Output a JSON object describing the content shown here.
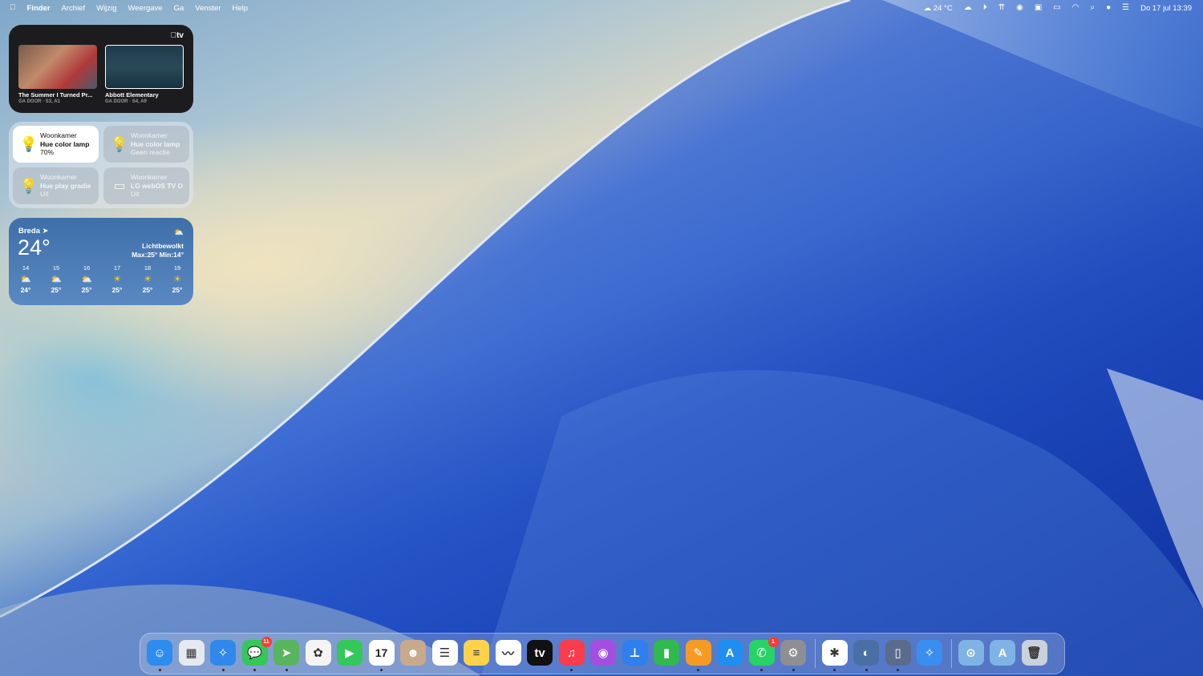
{
  "menubar": {
    "apple_icon": "apple-logo-icon",
    "items": [
      "Finder",
      "Archief",
      "Wijzig",
      "Weergave",
      "Ga",
      "Venster",
      "Help"
    ],
    "weather": "24 °C",
    "datetime": "Do 17 jul  13:39"
  },
  "tv_widget": {
    "logo": "tv",
    "items": [
      {
        "title": "The Summer I Turned Pr...",
        "subtitle": "GA DOOR · S3, A1"
      },
      {
        "title": "Abbott Elementary",
        "subtitle": "GA DOOR · S4, A9"
      }
    ]
  },
  "home_widget": {
    "tiles": [
      {
        "room": "Woonkamer",
        "name": "Hue color lamp",
        "status": "70%",
        "state": "on",
        "icon": "lightbulb-icon"
      },
      {
        "room": "Woonkamer",
        "name": "Hue color lamp",
        "status": "Geen reactie",
        "state": "off",
        "icon": "lightbulb-icon"
      },
      {
        "room": "Woonkamer",
        "name": "Hue play gradie",
        "status": "Uit",
        "state": "off",
        "icon": "lightbulb-icon"
      },
      {
        "room": "Woonkamer",
        "name": "LG webOS TV O",
        "status": "Uit",
        "state": "off",
        "icon": "tv-icon"
      }
    ]
  },
  "weather_widget": {
    "city": "Breda",
    "temp": "24°",
    "condition": "Lichtbewolkt",
    "range": "Max:25° Min:14°",
    "forecast": [
      {
        "hour": "14",
        "temp": "24°",
        "icon": "partly-cloudy-icon"
      },
      {
        "hour": "15",
        "temp": "25°",
        "icon": "partly-cloudy-icon"
      },
      {
        "hour": "16",
        "temp": "25°",
        "icon": "partly-cloudy-icon"
      },
      {
        "hour": "17",
        "temp": "25°",
        "icon": "sun-icon"
      },
      {
        "hour": "18",
        "temp": "25°",
        "icon": "sun-icon"
      },
      {
        "hour": "19",
        "temp": "25°",
        "icon": "sun-icon"
      }
    ]
  },
  "dock": {
    "apps": [
      {
        "name": "finder",
        "color": "#2d8cf0",
        "glyph": "☺",
        "running": true
      },
      {
        "name": "launchpad",
        "color": "#e6e9ef",
        "glyph": "▦",
        "running": false
      },
      {
        "name": "safari",
        "color": "#2f88ea",
        "glyph": "✧",
        "running": true
      },
      {
        "name": "messages",
        "color": "#34c759",
        "glyph": "💬",
        "running": true,
        "badge": "11"
      },
      {
        "name": "maps",
        "color": "#58b45e",
        "glyph": "➤",
        "running": true
      },
      {
        "name": "photos",
        "color": "#f4f4f4",
        "glyph": "✿",
        "running": false
      },
      {
        "name": "facetime",
        "color": "#34c759",
        "glyph": "▶",
        "running": false
      },
      {
        "name": "calendar",
        "color": "#ffffff",
        "glyph": "17",
        "running": true
      },
      {
        "name": "contacts",
        "color": "#c9a98b",
        "glyph": "☻",
        "running": false
      },
      {
        "name": "reminders",
        "color": "#ffffff",
        "glyph": "☰",
        "running": false
      },
      {
        "name": "notes",
        "color": "#ffd24a",
        "glyph": "≡",
        "running": false
      },
      {
        "name": "freeform",
        "color": "#ffffff",
        "glyph": "〰",
        "running": false
      },
      {
        "name": "apple-tv",
        "color": "#111111",
        "glyph": "tv",
        "running": false
      },
      {
        "name": "music",
        "color": "#fa3c4c",
        "glyph": "♫",
        "running": true
      },
      {
        "name": "podcasts",
        "color": "#a44ee0",
        "glyph": "◉",
        "running": false
      },
      {
        "name": "keynote",
        "color": "#2f80ed",
        "glyph": "⊥",
        "running": false
      },
      {
        "name": "numbers",
        "color": "#30b94e",
        "glyph": "▮",
        "running": false
      },
      {
        "name": "pages",
        "color": "#f59b23",
        "glyph": "✎",
        "running": true
      },
      {
        "name": "app-store",
        "color": "#1f8ef1",
        "glyph": "A",
        "running": false
      },
      {
        "name": "whatsapp",
        "color": "#25d366",
        "glyph": "✆",
        "running": true,
        "badge": "1"
      },
      {
        "name": "system-settings",
        "color": "#8e8e93",
        "glyph": "⚙",
        "running": true
      },
      {
        "name": "slack",
        "color": "#ffffff",
        "glyph": "✱",
        "running": true
      },
      {
        "name": "finder-utility",
        "color": "#4a6fa5",
        "glyph": "◐",
        "running": true
      },
      {
        "name": "iphone-mirroring",
        "color": "#5b6b8c",
        "glyph": "▯",
        "running": true
      },
      {
        "name": "safari-window",
        "color": "#3a8ef0",
        "glyph": "✧",
        "running": false
      },
      {
        "name": "downloads-folder",
        "color": "#7fb3e6",
        "glyph": "⊙",
        "running": false
      },
      {
        "name": "applications-folder",
        "color": "#7fb3e6",
        "glyph": "A",
        "running": false
      },
      {
        "name": "trash",
        "color": "#c9d1da",
        "glyph": "🗑",
        "running": false
      }
    ]
  }
}
